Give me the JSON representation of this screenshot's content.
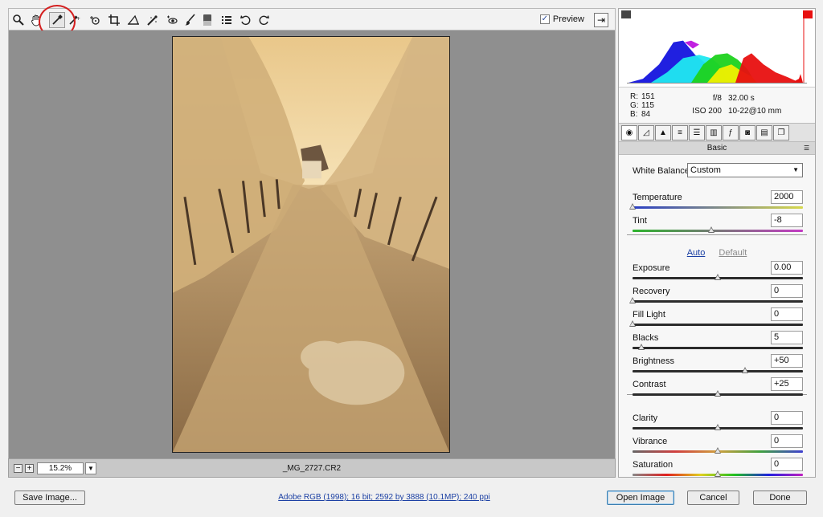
{
  "toolbar": {
    "tools": [
      "zoom-icon",
      "hand-icon",
      "white-balance-icon",
      "color-sampler-icon",
      "target-adjust-icon",
      "crop-icon",
      "straighten-icon",
      "spot-removal-icon",
      "red-eye-icon",
      "adjustment-brush-icon",
      "graduated-filter-icon",
      "preferences-icon",
      "rotate-ccw-icon",
      "rotate-cw-icon"
    ],
    "preview_label": "Preview",
    "preview_checked": true
  },
  "status": {
    "zoom_value": "15.2%",
    "filename": "_MG_2727.CR2"
  },
  "histogram": {
    "colors": {
      "red": "#e81010",
      "green": "#1ed21e",
      "blue": "#2020e0",
      "yellow": "#f0f000",
      "cyan": "#20e8f0",
      "magenta": "#c020e0"
    }
  },
  "info": {
    "r_label": "R:",
    "r_value": "151",
    "g_label": "G:",
    "g_value": "115",
    "b_label": "B:",
    "b_value": "84",
    "aperture": "f/8",
    "shutter": "32.00 s",
    "iso": "ISO 200",
    "lens": "10-22@10 mm"
  },
  "panel": {
    "section_title": "Basic",
    "white_balance_label": "White Balance:",
    "white_balance_value": "Custom",
    "auto_label": "Auto",
    "default_label": "Default",
    "sliders": [
      {
        "label": "Temperature",
        "value": "2000",
        "pos": 0.0
      },
      {
        "label": "Tint",
        "value": "-8",
        "pos": 0.46
      },
      {
        "label": "Exposure",
        "value": "0.00",
        "pos": 0.5
      },
      {
        "label": "Recovery",
        "value": "0",
        "pos": 0.0
      },
      {
        "label": "Fill Light",
        "value": "0",
        "pos": 0.0
      },
      {
        "label": "Blacks",
        "value": "5",
        "pos": 0.05
      },
      {
        "label": "Brightness",
        "value": "+50",
        "pos": 0.66
      },
      {
        "label": "Contrast",
        "value": "+25",
        "pos": 0.5
      },
      {
        "label": "Clarity",
        "value": "0",
        "pos": 0.5
      },
      {
        "label": "Vibrance",
        "value": "0",
        "pos": 0.5
      },
      {
        "label": "Saturation",
        "value": "0",
        "pos": 0.5
      }
    ]
  },
  "footer": {
    "save_label": "Save Image...",
    "workflow_link": "Adobe RGB (1998); 16 bit; 2592 by 3888 (10.1MP); 240 ppi",
    "open_label": "Open Image",
    "cancel_label": "Cancel",
    "done_label": "Done"
  }
}
